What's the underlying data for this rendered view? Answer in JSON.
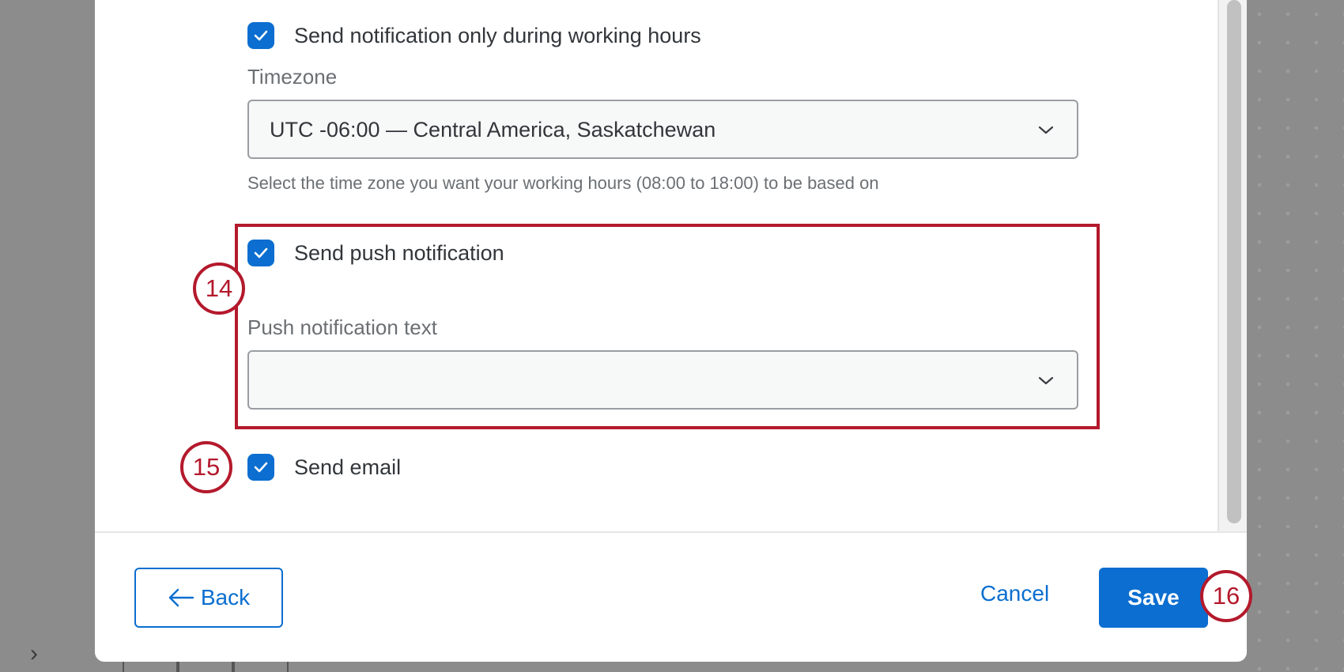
{
  "colors": {
    "accent": "#0b6ed0",
    "annotation": "#b4192c",
    "text": "#32363a",
    "muted_text": "#6b6f73"
  },
  "working_hours": {
    "checkbox_checked": true,
    "label": "Send notification only during working hours"
  },
  "timezone": {
    "label": "Timezone",
    "value": "UTC -06:00 — Central America, Saskatchewan",
    "helper": "Select the time zone you want your working hours (08:00 to 18:00) to be based on",
    "icon": "chevron-down-icon"
  },
  "push": {
    "checkbox_checked": true,
    "label": "Send push notification",
    "text_label": "Push notification text",
    "text_value": "",
    "icon": "chevron-down-icon"
  },
  "email": {
    "checkbox_checked": true,
    "label": "Send email"
  },
  "footer": {
    "back_label": "Back",
    "back_icon": "arrow-left-icon",
    "cancel_label": "Cancel",
    "save_label": "Save"
  },
  "annotations": {
    "step_14": "14",
    "step_15": "15",
    "step_16": "16"
  },
  "background": {
    "chevron_icon": "chevron-right-icon",
    "chevron_glyph": "›"
  }
}
